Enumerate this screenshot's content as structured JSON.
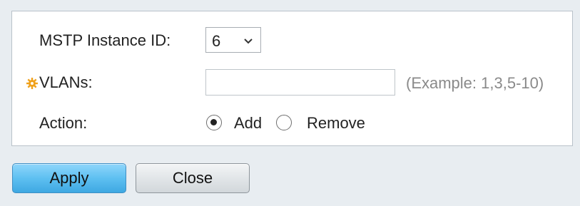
{
  "form": {
    "instance_label": "MSTP Instance ID:",
    "instance_value": "6",
    "vlans_label": "VLANs:",
    "vlans_value": "",
    "vlans_hint": "(Example: 1,3,5-10)",
    "action_label": "Action:",
    "action_options": [
      {
        "label": "Add",
        "selected": true
      },
      {
        "label": "Remove",
        "selected": false
      }
    ]
  },
  "buttons": {
    "apply_label": "Apply",
    "close_label": "Close"
  },
  "colors": {
    "required_icon": "#f0a21d",
    "apply_button": "#5ec0f1",
    "hint_text": "#8a8a8a"
  },
  "icons": {
    "required": "required-field-gear-icon",
    "dropdown": "chevron-down-icon"
  }
}
